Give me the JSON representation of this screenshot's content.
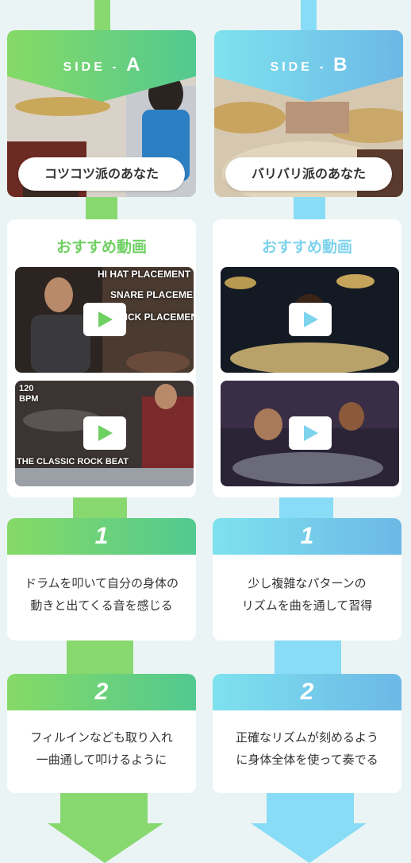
{
  "side_a": {
    "label_prefix": "SIDE -",
    "label_letter": "A",
    "pill": "コツコツ派のあなた",
    "videos_title": "おすすめ動画",
    "video1_overlays": [
      "HI HAT PLACEMENT",
      "SNARE PLACEMENT",
      "KICK PLACEMENT"
    ],
    "video2_overlays": [
      "120",
      "BPM",
      "THE CLASSIC ROCK BEAT"
    ],
    "step1": {
      "number": "1",
      "lines": [
        "ドラムを叩いて自分の身体の",
        "動きと出てくる音を感じる"
      ]
    },
    "step2": {
      "number": "2",
      "lines": [
        "フィルインなども取り入れ",
        "一曲通して叩けるように"
      ]
    }
  },
  "side_b": {
    "label_prefix": "SIDE -",
    "label_letter": "B",
    "pill": "バリバリ派のあなた",
    "videos_title": "おすすめ動画",
    "step1": {
      "number": "1",
      "lines": [
        "少し複雑なパターンの",
        "リズムを曲を通して習得"
      ]
    },
    "step2": {
      "number": "2",
      "lines": [
        "正確なリズムが刻めるよう",
        "に身体全体を使って奏でる"
      ]
    }
  },
  "colors": {
    "green": "#7dd66b",
    "green_dark": "#55c98e",
    "blue": "#7fdcf0",
    "blue_dark": "#6db6e6",
    "title_green": "#6fd062",
    "title_blue": "#7dd3ec"
  },
  "icons": [
    "play-icon",
    "down-arrow-icon"
  ]
}
